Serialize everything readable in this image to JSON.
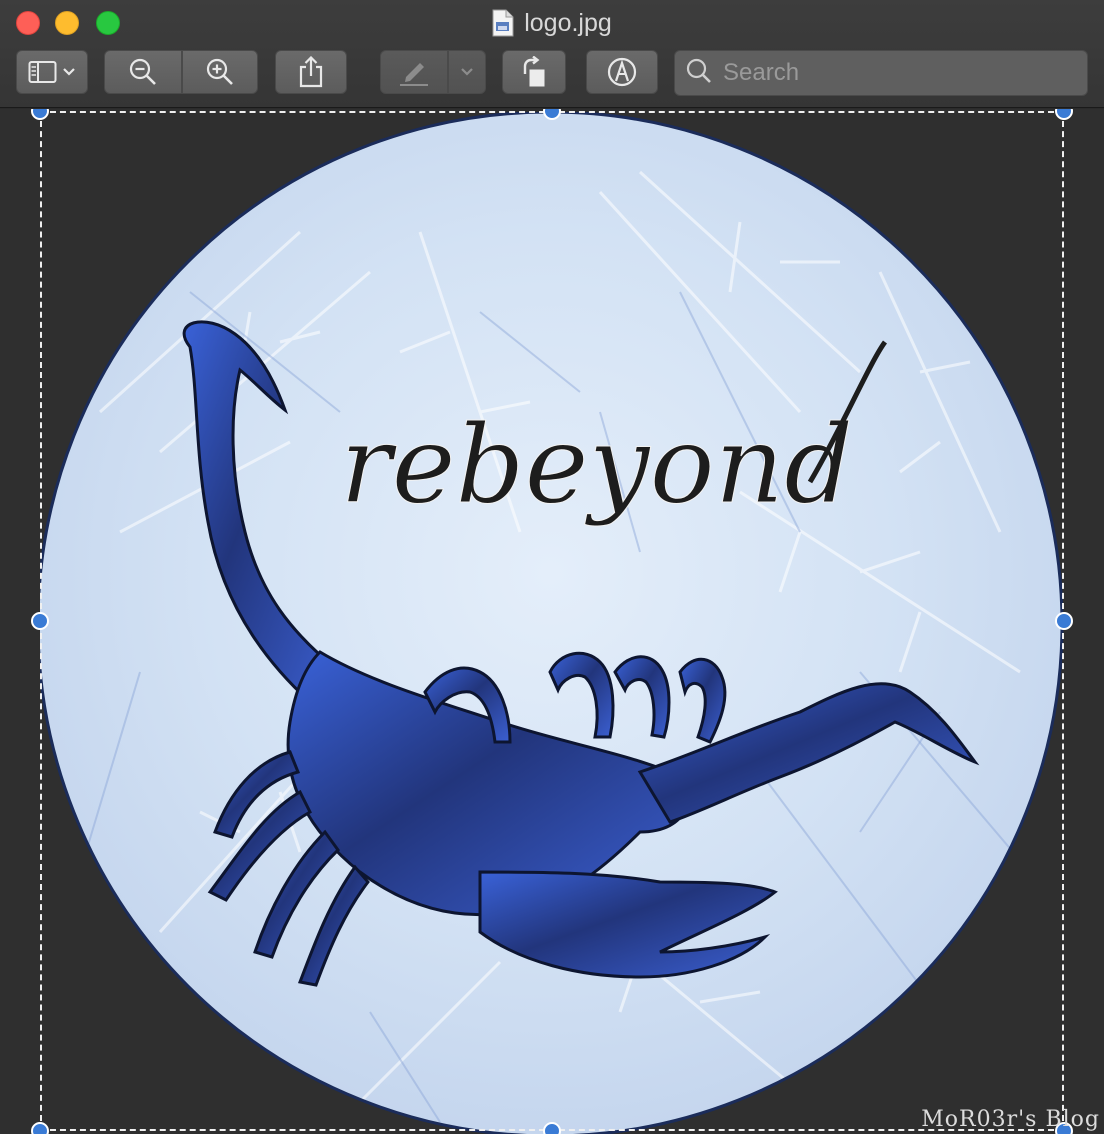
{
  "window": {
    "title": "logo.jpg"
  },
  "toolbar": {
    "search_placeholder": "Search",
    "icons": [
      "sidebar-icon",
      "chevron-down-icon",
      "zoom-out-icon",
      "zoom-in-icon",
      "share-icon",
      "markup-pen-icon",
      "rotate-icon",
      "annotate-icon",
      "search-icon"
    ]
  },
  "image": {
    "logo_text": "rebeyond",
    "watermark": "MoR03r's Blog"
  },
  "colors": {
    "close": "#fe5f57",
    "minimize": "#febc2e",
    "maximize": "#28c840",
    "selection_handle": "#3a7bd5",
    "scorpion_blue": "#2f4fbf",
    "frost_bg": "#dbe8f6"
  }
}
